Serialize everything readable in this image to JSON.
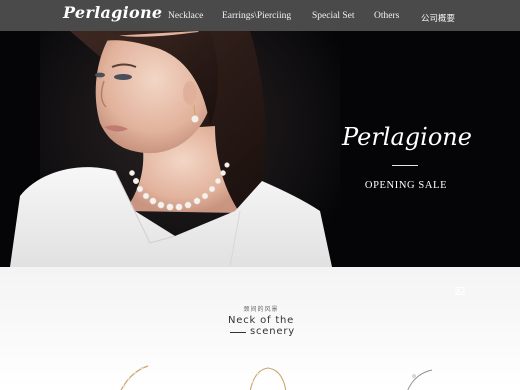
{
  "header": {
    "logo": "Perlagione",
    "nav": [
      {
        "label": "Necklace"
      },
      {
        "label": "Earrings\\Pierciing"
      },
      {
        "label": "Special Set"
      },
      {
        "label": "Others"
      },
      {
        "label": "公司概要"
      }
    ]
  },
  "hero": {
    "title": "Perlagione",
    "subtitle": "OPENING SALE"
  },
  "section": {
    "small_label": "颈间的风景",
    "title_line1": "Neck of the",
    "title_line2": "scenery"
  },
  "icons": {
    "side": "photo-icon"
  },
  "colors": {
    "header_bg": "#4a4a4a",
    "hero_bg": "#050507",
    "text_light": "#ffffff",
    "gold": "#c9a66b"
  }
}
